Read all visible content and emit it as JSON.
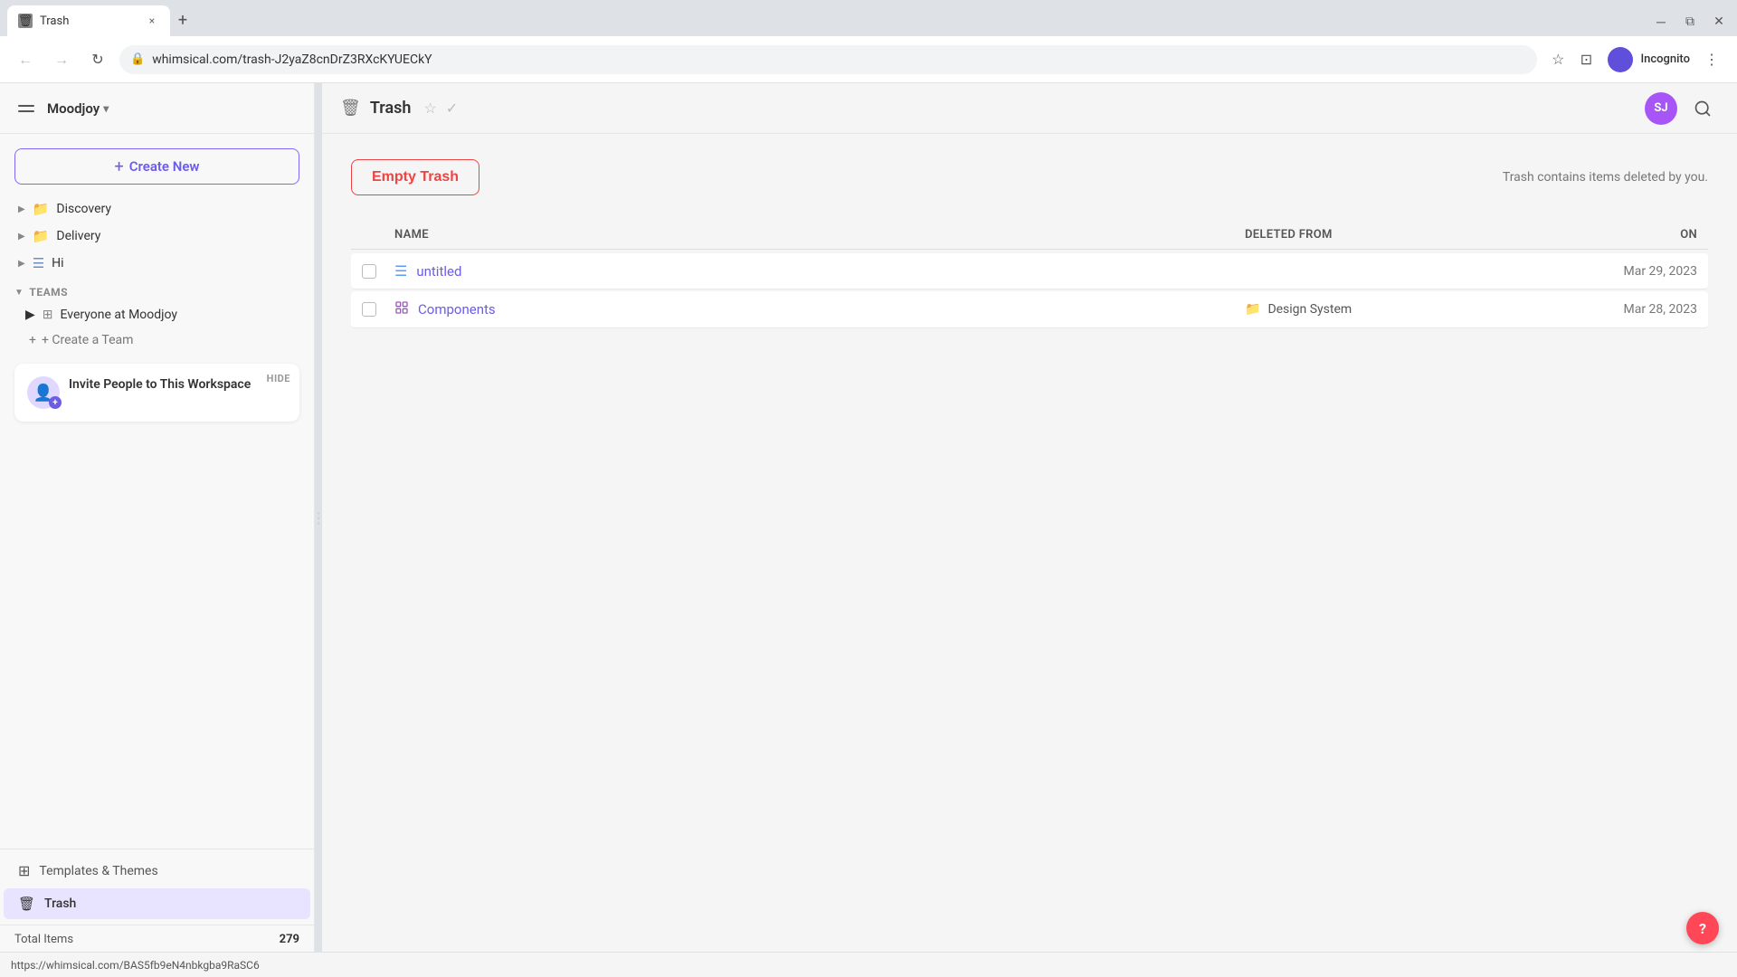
{
  "browser": {
    "tab_title": "Trash",
    "tab_favicon": "🗑",
    "close_btn": "×",
    "new_tab_btn": "+",
    "url": "whimsical.com/trash-J2yaZ8cnDrZ3RXcKYUECkY",
    "back_btn": "←",
    "forward_btn": "→",
    "refresh_btn": "↻",
    "bookmark_icon": "★",
    "profile_btn_label": "Incognito",
    "menu_dots": "⋮",
    "status_bar_url": "https://whimsical.com/BAS5fb9eN4nbkgba9RaSC6"
  },
  "sidebar": {
    "workspace_name": "Moodjoy",
    "create_new_label": "+ Create New",
    "nav_items": [
      {
        "id": "discovery",
        "label": "Discovery",
        "icon": "folder_brown",
        "chevron": "▶"
      },
      {
        "id": "delivery",
        "label": "Delivery",
        "icon": "folder_brown",
        "chevron": "▶"
      },
      {
        "id": "hi",
        "label": "Hi",
        "icon": "doc",
        "chevron": "▶"
      }
    ],
    "teams_section_label": "TEAMS",
    "teams_chevron": "▼",
    "team_items": [
      {
        "id": "everyone",
        "label": "Everyone at Moodjoy",
        "chevron": "▶"
      }
    ],
    "create_team_label": "+ Create a Team",
    "invite_card": {
      "hide_label": "HIDE",
      "title": "Invite People to This Workspace"
    },
    "templates_label": "Templates & Themes",
    "trash_label": "Trash",
    "total_items_label": "Total Items",
    "total_items_count": "279"
  },
  "main": {
    "page_title": "Trash",
    "empty_trash_label": "Empty Trash",
    "trash_info": "Trash contains items deleted by you.",
    "user_initials": "SJ",
    "table": {
      "col_name": "Name",
      "col_deleted_from": "Deleted From",
      "col_on": "On",
      "rows": [
        {
          "id": "untitled",
          "icon_type": "doc",
          "name": "untitled",
          "deleted_from": "",
          "date": "Mar 29, 2023"
        },
        {
          "id": "components",
          "icon_type": "component",
          "name": "Components",
          "deleted_from": "Design System",
          "date": "Mar 28, 2023"
        }
      ]
    }
  },
  "help_btn": "?"
}
